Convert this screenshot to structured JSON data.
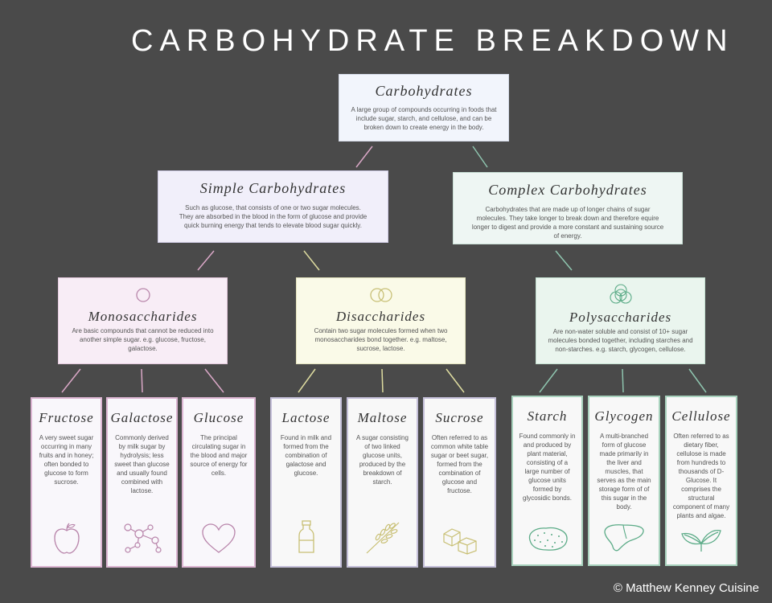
{
  "title": "CARBOHYDRATE BREAKDOWN",
  "copyright": "© Matthew Kenney Cuisine",
  "colors": {
    "background": "#4a4a4a",
    "blue": "#f2f5fc",
    "lavender": "#f1effa",
    "mint": "#eef6f3",
    "pink": "#f8edf6",
    "yellow": "#fafae8",
    "green": "#eaf5ee",
    "pink_border": "#dcb5d2",
    "lavender_border": "#c4bfd9",
    "green_border": "#a8d2bd"
  },
  "root": {
    "title": "Carbohydrates",
    "desc": "A large group of compounds occurring in foods that include sugar, starch, and cellulose, and can be broken down to create energy in the body."
  },
  "simple": {
    "title": "Simple Carbohydrates",
    "desc": "Such as glucose, that consists of one or two sugar molecules. They are absorbed in the blood in the form of glucose and provide quick burning energy that tends to elevate blood sugar quickly."
  },
  "complex": {
    "title": "Complex Carbohydrates",
    "desc": "Carbohydrates that are made up of longer chains of sugar molecules. They take longer to break down and therefore equire longer to digest and provide a more constant and sustaining source of energy."
  },
  "mono": {
    "title": "Monosaccharides",
    "desc": "Are basic compounds that cannot be reduced into another simple sugar. e.g. glucose, fructose, galactose.",
    "icon": "single-circle-icon"
  },
  "di": {
    "title": "Disaccharides",
    "desc": "Contain two sugar molecules formed when two monosaccharides bond together. e.g. maltose, sucrose, lactose.",
    "icon": "double-circle-icon"
  },
  "poly": {
    "title": "Polysaccharides",
    "desc": "Are non-water soluble and consist of 10+ sugar molecules bonded together, including starches and non-starches. e.g. starch, glycogen, cellulose.",
    "icon": "multi-circle-icon"
  },
  "leaves": [
    {
      "title": "Fructose",
      "desc": "A very sweet sugar occurring in many fruits and in honey; often bonded to glucose to form sucrose.",
      "icon": "apple-icon"
    },
    {
      "title": "Galactose",
      "desc": "Commonly derived by milk sugar by hydrolysis; less sweet than glucose and usually found combined with lactose.",
      "icon": "molecule-icon"
    },
    {
      "title": "Glucose",
      "desc": "The principal circulating sugar in the blood and major source of energy for cells.",
      "icon": "heart-icon"
    },
    {
      "title": "Lactose",
      "desc": "Found in milk and formed from the combination of galactose and glucose.",
      "icon": "milk-bottle-icon"
    },
    {
      "title": "Maltose",
      "desc": "A sugar consisting of two linked glucose units, produced by the breakdown of starch.",
      "icon": "wheat-icon"
    },
    {
      "title": "Sucrose",
      "desc": "Often referred to as common white table sugar or beet sugar, formed from the combination of glucose and fructose.",
      "icon": "sugar-cubes-icon"
    },
    {
      "title": "Starch",
      "desc": "Found commonly in and produced by plant material, consisting of a large number of glucose units formed by glycosidic bonds.",
      "icon": "potato-icon"
    },
    {
      "title": "Glycogen",
      "desc": "A multi-branched form of glucose made primarily in the liver and muscles, that serves as the main storage form of of this sugar in the body.",
      "icon": "liver-icon"
    },
    {
      "title": "Cellulose",
      "desc": "Often referred to as dietary fiber, cellulose is made from hundreds to thousands of D-Glucose. It comprises the structural component of many plants and algae.",
      "icon": "leaves-icon"
    }
  ]
}
